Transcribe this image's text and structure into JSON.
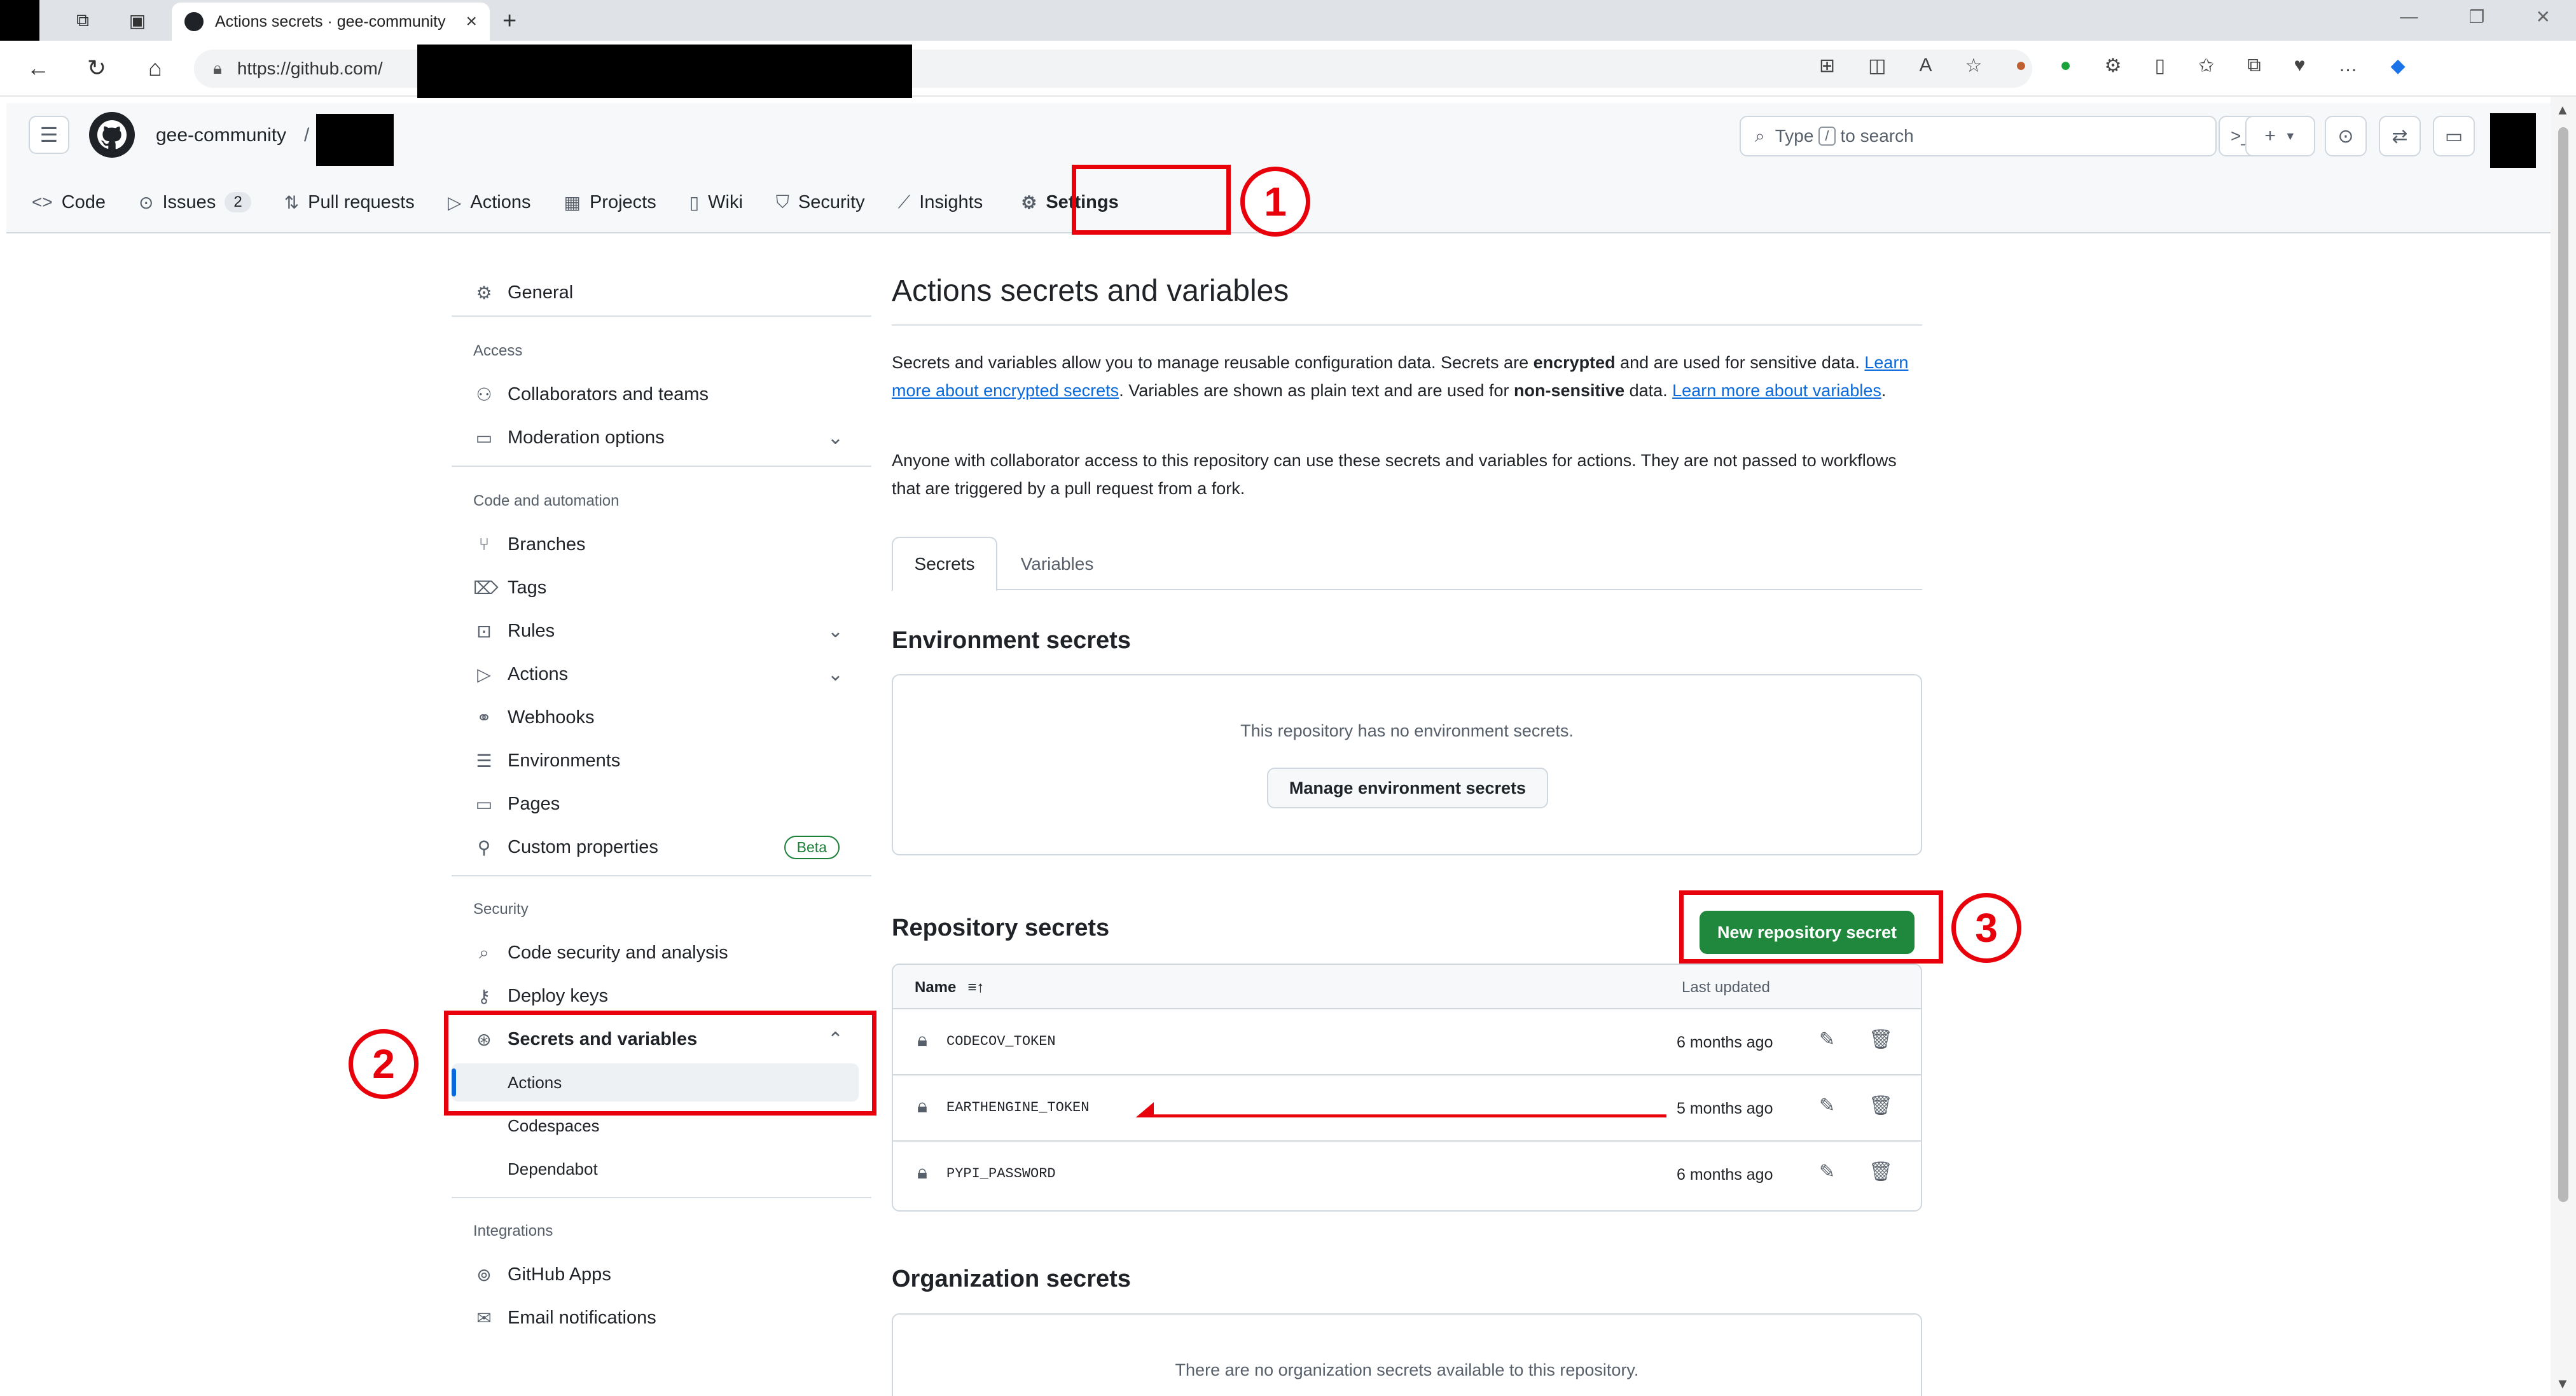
{
  "browser": {
    "tab_title": "Actions secrets · gee-community",
    "url": "https://github.com/",
    "tab_close": "×",
    "new_tab": "+"
  },
  "header": {
    "owner": "gee-community",
    "separator": "/",
    "search_placeholder_pre": "Type",
    "search_key": "/",
    "search_placeholder_post": "to search"
  },
  "repo_nav": {
    "items": [
      {
        "label": "Code",
        "icon": "code-icon"
      },
      {
        "label": "Issues",
        "icon": "issue-opened-icon",
        "count": "2"
      },
      {
        "label": "Pull requests",
        "icon": "git-pull-request-icon"
      },
      {
        "label": "Actions",
        "icon": "play-icon"
      },
      {
        "label": "Projects",
        "icon": "table-icon"
      },
      {
        "label": "Wiki",
        "icon": "book-icon"
      },
      {
        "label": "Security",
        "icon": "shield-icon"
      },
      {
        "label": "Insights",
        "icon": "graph-icon"
      },
      {
        "label": "Settings",
        "icon": "gear-icon"
      }
    ]
  },
  "annotations": {
    "one": "1",
    "two": "2",
    "three": "3",
    "color": "#e8000b"
  },
  "sidebar": {
    "general": "General",
    "access_heading": "Access",
    "collaborators": "Collaborators and teams",
    "moderation": "Moderation options",
    "code_heading": "Code and automation",
    "branches": "Branches",
    "tags": "Tags",
    "rules": "Rules",
    "actions": "Actions",
    "webhooks": "Webhooks",
    "environments": "Environments",
    "pages": "Pages",
    "custom_properties": "Custom properties",
    "beta": "Beta",
    "security_heading": "Security",
    "code_security": "Code security and analysis",
    "deploy_keys": "Deploy keys",
    "secrets_vars": "Secrets and variables",
    "sub_actions": "Actions",
    "sub_codespaces": "Codespaces",
    "sub_dependabot": "Dependabot",
    "integrations_heading": "Integrations",
    "github_apps": "GitHub Apps",
    "email_notifications": "Email notifications"
  },
  "main": {
    "title": "Actions secrets and variables",
    "p1_a": "Secrets and variables allow you to manage reusable configuration data. Secrets are ",
    "p1_b": "encrypted",
    "p1_c": " and are used for sensitive data. ",
    "p1_link1": "Learn more about encrypted secrets",
    "p1_d": ". Variables are shown as plain text and are used for ",
    "p1_e": "non-sensitive",
    "p1_f": " data. ",
    "p1_link2": "Learn more about variables",
    "p1_g": ".",
    "p2": "Anyone with collaborator access to this repository can use these secrets and variables for actions. They are not passed to workflows that are triggered by a pull request from a fork.",
    "tab_secrets": "Secrets",
    "tab_variables": "Variables",
    "env_title": "Environment secrets",
    "env_empty": "This repository has no environment secrets.",
    "env_button": "Manage environment secrets",
    "repo_title": "Repository secrets",
    "new_secret": "New repository secret",
    "col_name": "Name",
    "col_updated": "Last updated",
    "secrets": [
      {
        "name": "CODECOV_TOKEN",
        "updated": "6 months ago"
      },
      {
        "name": "EARTHENGINE_TOKEN",
        "updated": "5 months ago"
      },
      {
        "name": "PYPI_PASSWORD",
        "updated": "6 months ago"
      }
    ],
    "org_title": "Organization secrets",
    "org_empty": "There are no organization secrets available to this repository."
  }
}
